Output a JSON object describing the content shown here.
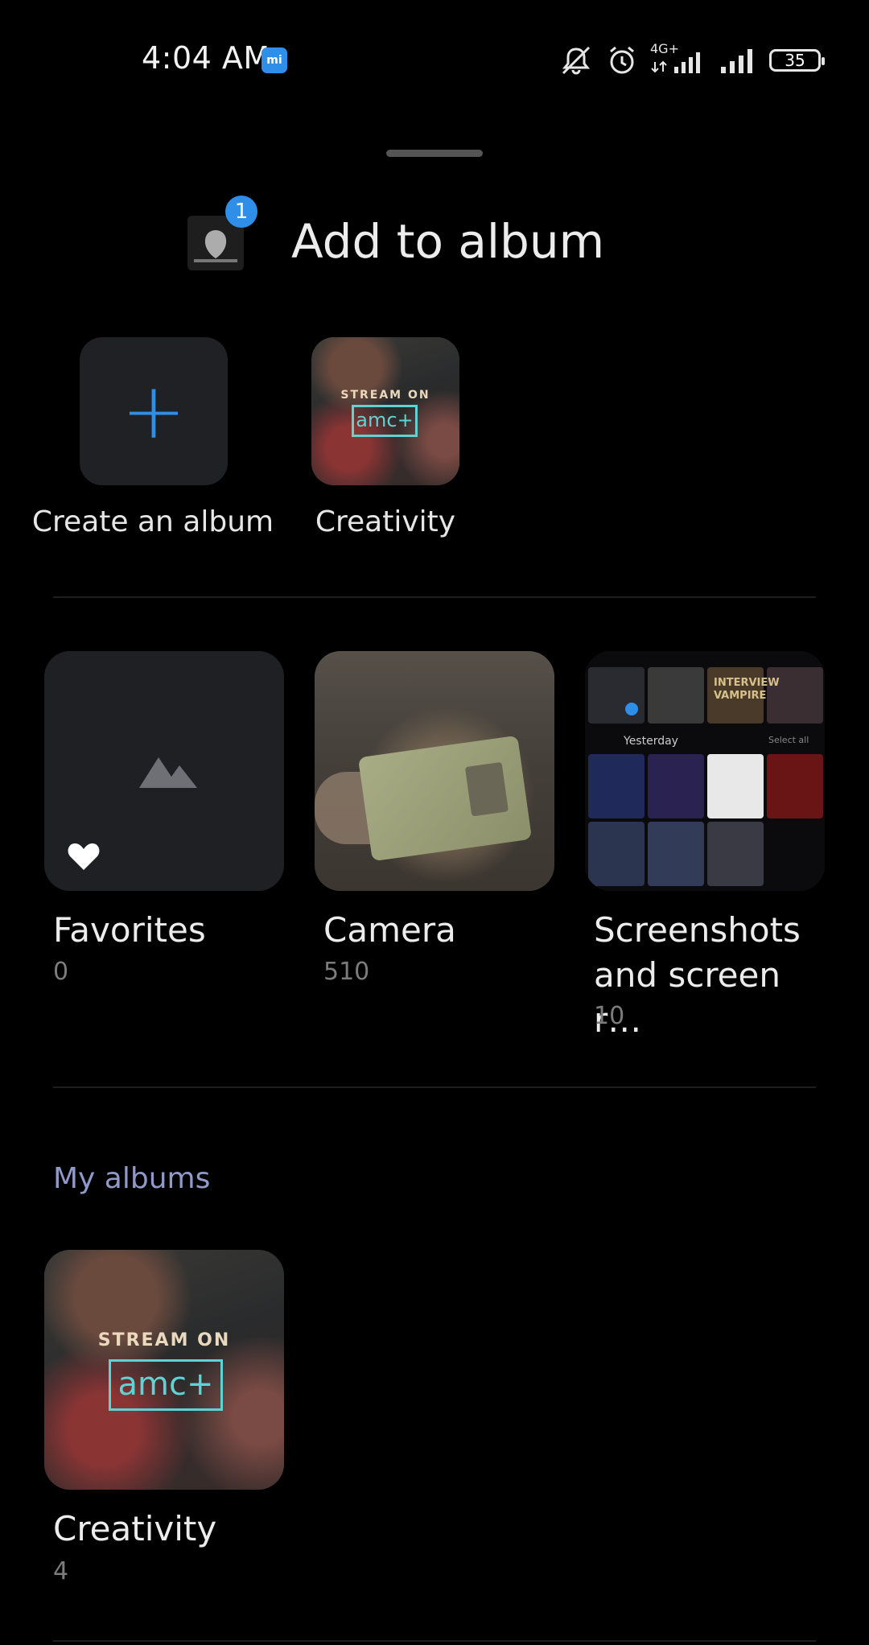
{
  "status_bar": {
    "time": "4:04 AM",
    "mi_label": "mi",
    "network_label": "4G+",
    "battery": "35"
  },
  "header": {
    "title": "Add to album",
    "selected_count": "1"
  },
  "quick_actions": [
    {
      "label": "Create an album"
    },
    {
      "label": "Creativity"
    }
  ],
  "system_albums": [
    {
      "name": "Favorites",
      "count": "0"
    },
    {
      "name": "Camera",
      "count": "510"
    },
    {
      "name": "Screenshots\nand screen r…",
      "count": "10"
    }
  ],
  "section_title": "My albums",
  "my_albums": [
    {
      "name": "Creativity",
      "count": "4"
    }
  ],
  "thumb_text": {
    "stream_on": "STREAM ON",
    "amc": "amc+",
    "yesterday": "Yesterday",
    "select_all": "Select all",
    "interview": "INTERVIEW\nVAMPIRE"
  },
  "colors": {
    "accent": "#2f8fe8",
    "section": "#8f9ac8",
    "background": "#000000"
  }
}
